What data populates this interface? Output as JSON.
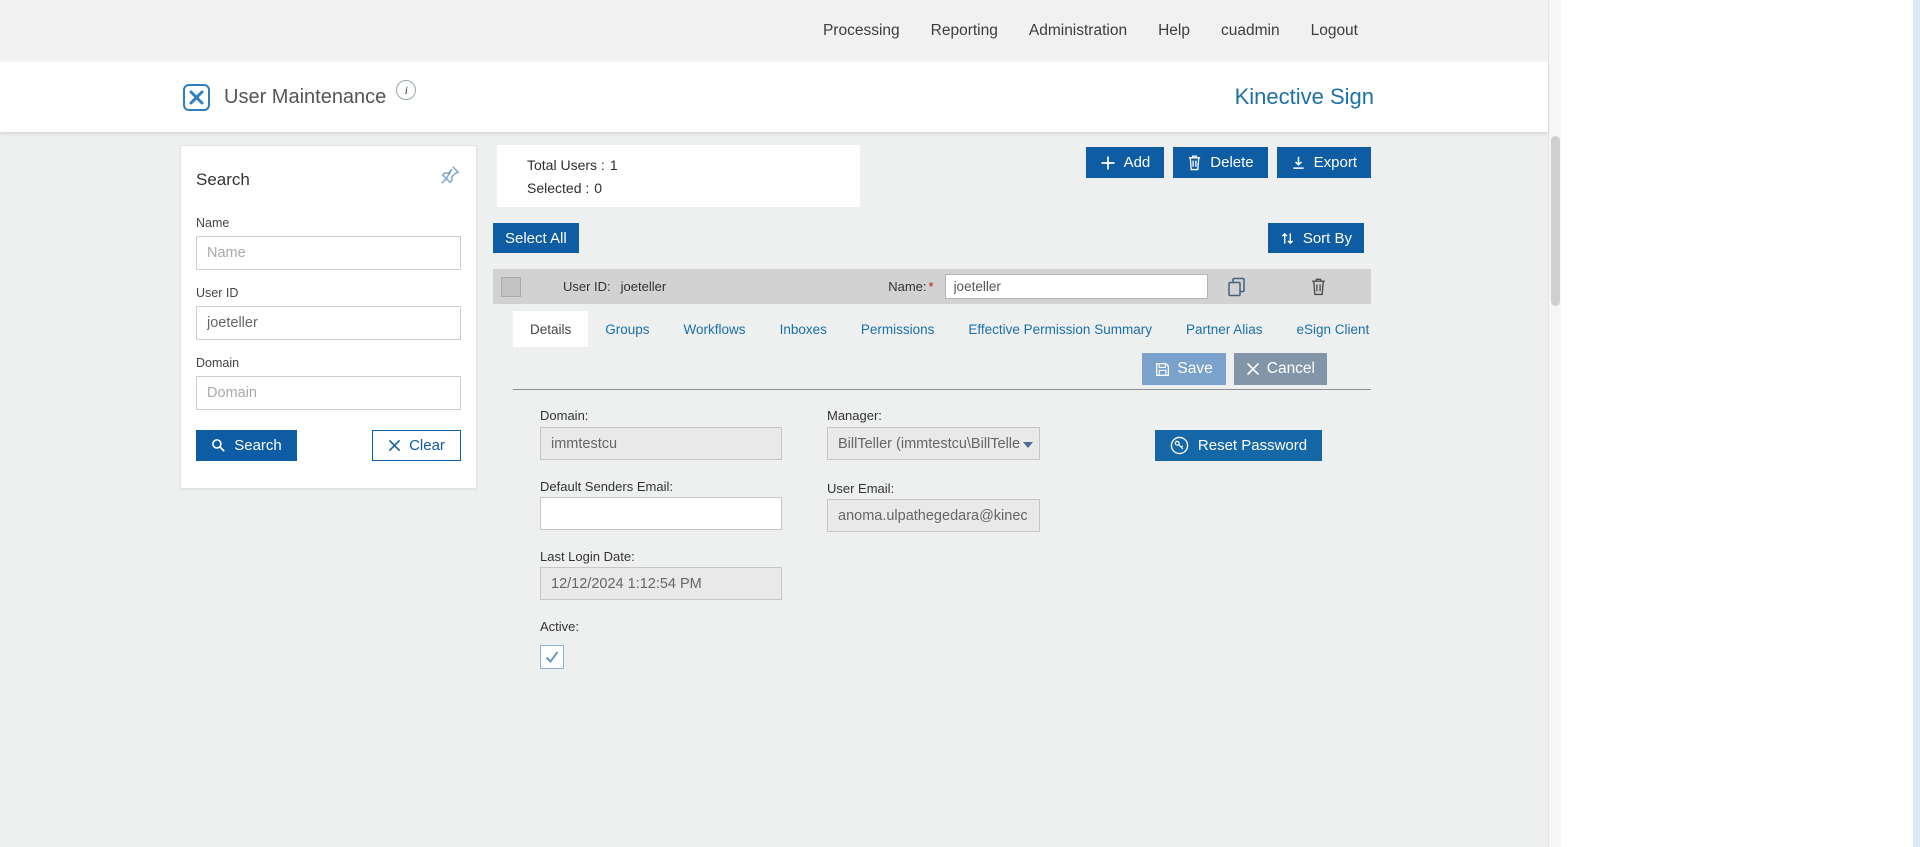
{
  "colors": {
    "primary": "#0e5ca4",
    "brand": "#1d70a8",
    "link": "#1a6fa8",
    "save": "#7aa2cb",
    "cancel": "#8295a9",
    "page-bg": "#eef0f0",
    "bar-gray": "#d2d2d2",
    "required": "#cc1111"
  },
  "topnav": {
    "items": [
      "Processing",
      "Reporting",
      "Administration",
      "Help",
      "cuadmin",
      "Logout"
    ]
  },
  "header": {
    "title": "User Maintenance",
    "info_glyph": "i",
    "brand": "Kinective Sign"
  },
  "search_panel": {
    "title": "Search",
    "name_label": "Name",
    "name_placeholder": "Name",
    "name_value": "",
    "user_id_label": "User ID",
    "user_id_value": "joeteller",
    "domain_label": "Domain",
    "domain_placeholder": "Domain",
    "domain_value": "",
    "search_button": "Search",
    "clear_button": "Clear"
  },
  "summary": {
    "total_label": "Total Users :",
    "total_value": "1",
    "selected_label": "Selected :",
    "selected_value": "0"
  },
  "toolbar": {
    "add": "Add",
    "delete": "Delete",
    "export": "Export",
    "select_all": "Select All",
    "sort_by": "Sort By"
  },
  "user_row": {
    "user_id_label": "User ID:",
    "user_id_value": "joeteller",
    "name_label": "Name:",
    "required_marker": "*",
    "name_value": "joeteller"
  },
  "tabs": {
    "items": [
      "Details",
      "Groups",
      "Workflows",
      "Inboxes",
      "Permissions",
      "Effective Permission Summary",
      "Partner Alias",
      "eSign Client"
    ],
    "active": "Details"
  },
  "detail_form": {
    "save_button": "Save",
    "cancel_button": "Cancel",
    "domain_label": "Domain:",
    "domain_value": "immtestcu",
    "manager_label": "Manager:",
    "manager_value": "BillTeller (immtestcu\\BillTelle",
    "reset_password_button": "Reset Password",
    "default_senders_email_label": "Default Senders Email:",
    "default_senders_email_value": "",
    "user_email_label": "User Email:",
    "user_email_value": "anoma.ulpathegedara@kinec",
    "last_login_label": "Last Login Date:",
    "last_login_value": "12/12/2024 1:12:54 PM",
    "active_label": "Active:",
    "active_checked": true
  }
}
